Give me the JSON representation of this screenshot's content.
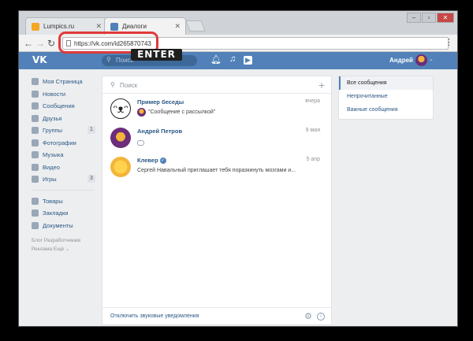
{
  "browser": {
    "tabs": [
      {
        "label": "Lumpics.ru",
        "fav_color": "#f5a623"
      },
      {
        "label": "Диалоги",
        "fav_color": "#5181b8"
      }
    ],
    "address": "https://vk.com/id265870743",
    "overlay_label": "ENTER"
  },
  "vk": {
    "search_placeholder": "Поиск",
    "user_name": "Андрей"
  },
  "nav": {
    "items": [
      {
        "label": "Моя Страница",
        "count": ""
      },
      {
        "label": "Новости",
        "count": ""
      },
      {
        "label": "Сообщения",
        "count": ""
      },
      {
        "label": "Друзья",
        "count": ""
      },
      {
        "label": "Группы",
        "count": "1"
      },
      {
        "label": "Фотографии",
        "count": ""
      },
      {
        "label": "Музыка",
        "count": ""
      },
      {
        "label": "Видео",
        "count": ""
      },
      {
        "label": "Игры",
        "count": "3"
      }
    ],
    "items2": [
      {
        "label": "Товары"
      },
      {
        "label": "Закладки"
      },
      {
        "label": "Документы"
      }
    ],
    "footer_line1": "Блог   Разработчикам",
    "footer_line2": "Реклама   Ещё ⌄"
  },
  "messages": {
    "search_placeholder": "Поиск",
    "conversations": [
      {
        "name": "Пример беседы",
        "time": "вчера",
        "message": "\"Сообщение с рассылкой\"",
        "avatar_color": "#222"
      },
      {
        "name": "Андрей Петров",
        "time": "9 мая",
        "message": "",
        "avatar_color": "#6c2d7a"
      },
      {
        "name": "Клевер",
        "time": "5 апр",
        "message": "Сергей Навальный приглашает тебя поразкинуть мозгами и...",
        "avatar_color": "#f3b53a"
      }
    ],
    "footer_link": "Отключить звуковые уведомления"
  },
  "filters": {
    "items": [
      "Все сообщения",
      "Непрочитанные",
      "Важные сообщения"
    ]
  }
}
